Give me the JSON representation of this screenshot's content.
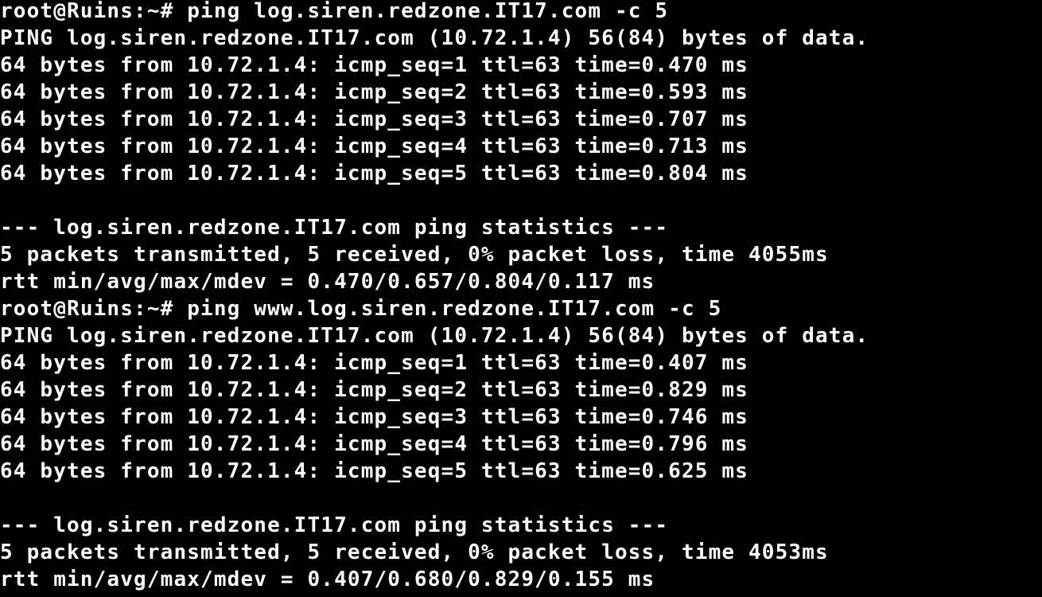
{
  "terminal": {
    "background": "#000000",
    "foreground": "#ffffff",
    "lines": [
      "root@Ruins:~# ping log.siren.redzone.IT17.com -c 5",
      "PING log.siren.redzone.IT17.com (10.72.1.4) 56(84) bytes of data.",
      "64 bytes from 10.72.1.4: icmp_seq=1 ttl=63 time=0.470 ms",
      "64 bytes from 10.72.1.4: icmp_seq=2 ttl=63 time=0.593 ms",
      "64 bytes from 10.72.1.4: icmp_seq=3 ttl=63 time=0.707 ms",
      "64 bytes from 10.72.1.4: icmp_seq=4 ttl=63 time=0.713 ms",
      "64 bytes from 10.72.1.4: icmp_seq=5 ttl=63 time=0.804 ms",
      "",
      "--- log.siren.redzone.IT17.com ping statistics ---",
      "5 packets transmitted, 5 received, 0% packet loss, time 4055ms",
      "rtt min/avg/max/mdev = 0.470/0.657/0.804/0.117 ms",
      "root@Ruins:~# ping www.log.siren.redzone.IT17.com -c 5",
      "PING log.siren.redzone.IT17.com (10.72.1.4) 56(84) bytes of data.",
      "64 bytes from 10.72.1.4: icmp_seq=1 ttl=63 time=0.407 ms",
      "64 bytes from 10.72.1.4: icmp_seq=2 ttl=63 time=0.829 ms",
      "64 bytes from 10.72.1.4: icmp_seq=3 ttl=63 time=0.746 ms",
      "64 bytes from 10.72.1.4: icmp_seq=4 ttl=63 time=0.796 ms",
      "64 bytes from 10.72.1.4: icmp_seq=5 ttl=63 time=0.625 ms",
      "",
      "--- log.siren.redzone.IT17.com ping statistics ---",
      "5 packets transmitted, 5 received, 0% packet loss, time 4053ms",
      "rtt min/avg/max/mdev = 0.407/0.680/0.829/0.155 ms"
    ]
  }
}
